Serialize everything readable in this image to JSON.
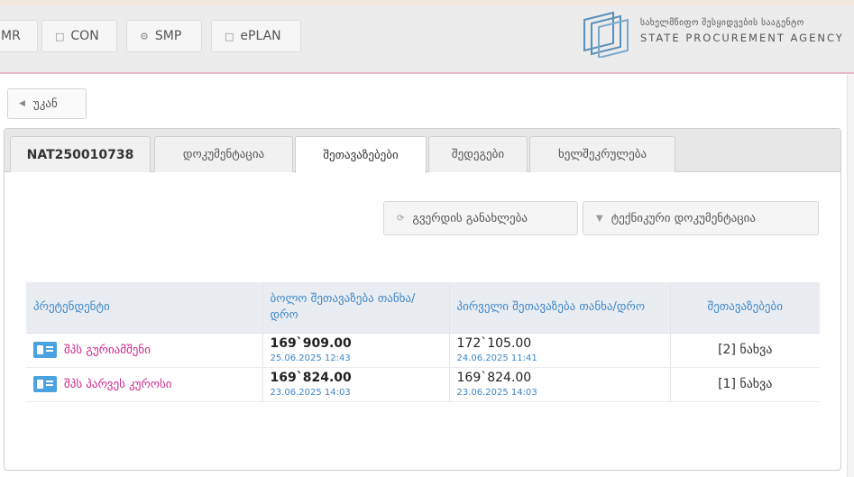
{
  "nav": {
    "items": [
      {
        "label": "MR",
        "icon": "none"
      },
      {
        "label": "CON",
        "icon": "document-icon"
      },
      {
        "label": "SMP",
        "icon": "gear-icon"
      },
      {
        "label": "ePLAN",
        "icon": "document-icon"
      }
    ]
  },
  "logo": {
    "geo_text": "სახელმწიფო შესყიდვების სააგენტო",
    "en_text": "STATE PROCUREMENT AGENCY"
  },
  "back_button": {
    "label": "უკან",
    "icon": "caret-left-icon"
  },
  "tabs": [
    {
      "label": "NAT250010738"
    },
    {
      "label": "დოკუმენტაცია"
    },
    {
      "label": "შეთავაზებები"
    },
    {
      "label": "შედეგები"
    },
    {
      "label": "ხელშეკრულება"
    }
  ],
  "actions": {
    "review": {
      "label": "გვერდის განახლება",
      "icon": "refresh-icon"
    },
    "techdoc": {
      "label": "ტექნიკური დოკუმენტაცია",
      "icon": "caret-down-icon"
    }
  },
  "table": {
    "headers": {
      "bidder": "პრეტენდენტი",
      "last_offer": "ბოლო შეთავაზება თანხა/დრო",
      "first_offer": "პირველი შეთავაზება თანხა/დრო",
      "offers": "შეთავაზებები"
    },
    "rows": [
      {
        "bidder": "შპს გურიამშენი",
        "last_amount": "169`909.00",
        "last_date": "25.06.2025 12:43",
        "first_amount": "172`105.00",
        "first_date": "24.06.2025 11:41",
        "offers": "[2] ნახვა"
      },
      {
        "bidder": "შპს პარვეს კუროსი",
        "last_amount": "169`824.00",
        "last_date": "23.06.2025 14:03",
        "first_amount": "169`824.00",
        "first_date": "23.06.2025 14:03",
        "offers": "[1] ნახვა"
      }
    ]
  },
  "colors": {
    "link_blue": "#3e86c6",
    "bidder_pink": "#d0268c",
    "topbar_border": "#e7b8c9"
  }
}
